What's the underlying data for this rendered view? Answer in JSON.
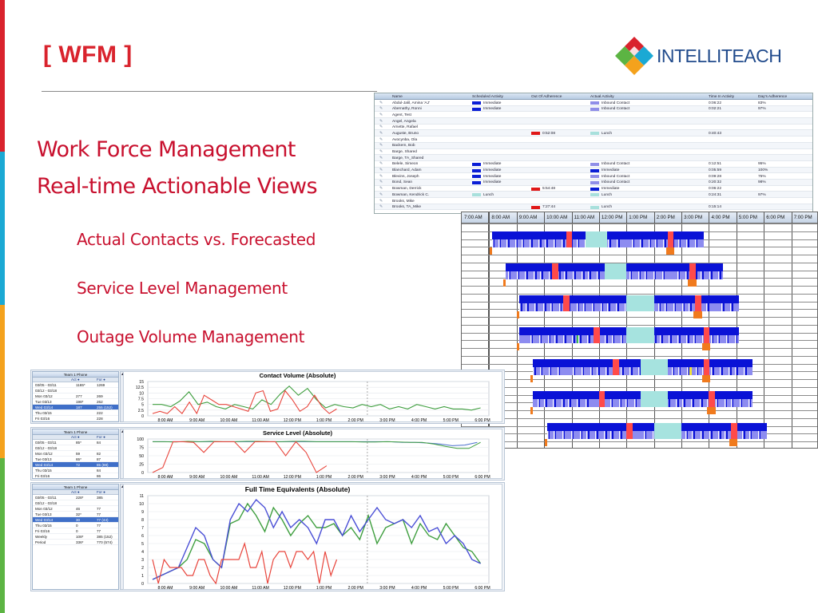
{
  "brand": {
    "edge_colors": [
      "#d9232d",
      "#1ba9d4",
      "#f4a21d",
      "#5cb443"
    ],
    "accent": "#c8102e",
    "logo_colors": [
      "#d9232d",
      "#1ba9d4",
      "#f4a21d",
      "#5cb443"
    ]
  },
  "slide": {
    "tag": "[ WFM ]",
    "headline_1": "Work Force Management",
    "headline_2": "Real-time Actionable Views",
    "bullets": [
      "Actual Contacts vs. Forecasted",
      "Service Level Management",
      "Outage Volume Management"
    ]
  },
  "logo": {
    "text": "INTELLITEACH",
    "icon": "diamond-logo-icon"
  },
  "adherence_table": {
    "columns": [
      "Name",
      "Scheduled Activity",
      "Out Of Adherence",
      "Actual Activity",
      "Time In Activity",
      "Day's Adherence"
    ],
    "rows": [
      {
        "name": "Abdul-Jalil, Amina 'AJ'",
        "sched": "Immediate",
        "out": "",
        "actual": "Inbound Contact",
        "time": "0:06:22",
        "adh": "83%"
      },
      {
        "name": "Abernathy, Ronni",
        "sched": "Immediate",
        "out": "",
        "actual": "Inbound Contact",
        "time": "0:02:21",
        "adh": "97%"
      },
      {
        "name": "Agent, Test",
        "sched": "",
        "out": "",
        "actual": "",
        "time": "",
        "adh": ""
      },
      {
        "name": "Angel, Angela",
        "sched": "",
        "out": "",
        "actual": "",
        "time": "",
        "adh": ""
      },
      {
        "name": "Arnette, Rafael",
        "sched": "",
        "out": "",
        "actual": "",
        "time": "",
        "adh": ""
      },
      {
        "name": "Auguste, Bruno",
        "sched": "",
        "out": "0:52:08",
        "actual": "Lunch",
        "time": "0:40:43",
        "adh": ""
      },
      {
        "name": "Avocynba, Ola",
        "sched": "",
        "out": "",
        "actual": "",
        "time": "",
        "adh": ""
      },
      {
        "name": "Backem, Bob",
        "sched": "",
        "out": "",
        "actual": "",
        "time": "",
        "adh": ""
      },
      {
        "name": "Barge, Shared",
        "sched": "",
        "out": "",
        "actual": "",
        "time": "",
        "adh": ""
      },
      {
        "name": "Barge, TA_Shared",
        "sched": "",
        "out": "",
        "actual": "",
        "time": "",
        "adh": ""
      },
      {
        "name": "Belele, Simeon",
        "sched": "Immediate",
        "out": "",
        "actual": "Inbound Contact",
        "time": "0:12:51",
        "adh": "95%"
      },
      {
        "name": "Blanchard, Adam",
        "sched": "Immediate",
        "out": "",
        "actual": "Immediate",
        "time": "0:05:59",
        "adh": "100%"
      },
      {
        "name": "Blevins, Joseph",
        "sched": "Immediate",
        "out": "",
        "actual": "Inbound Contact",
        "time": "0:09:28",
        "adh": "75%"
      },
      {
        "name": "Bond, Sean",
        "sched": "Immediate",
        "out": "",
        "actual": "Inbound Contact",
        "time": "0:20:32",
        "adh": "98%"
      },
      {
        "name": "Bowman, Derrick",
        "sched": "",
        "out": "5:54:48",
        "actual": "Immediate",
        "time": "0:06:22",
        "adh": ""
      },
      {
        "name": "Bowman, Kendrick C.",
        "sched": "Lunch",
        "out": "",
        "actual": "Lunch",
        "time": "0:24:31",
        "adh": "97%"
      },
      {
        "name": "Brooks, Mike",
        "sched": "",
        "out": "",
        "actual": "",
        "time": "",
        "adh": ""
      },
      {
        "name": "Brooks, TA_Mike",
        "sched": "",
        "out": "7:27:44",
        "actual": "Lunch",
        "time": "0:15:14",
        "adh": ""
      }
    ]
  },
  "gantt": {
    "hours": [
      "7:00 AM",
      "8:00 AM",
      "9:00 AM",
      "10:00 AM",
      "11:00 AM",
      "12:00 PM",
      "1:00 PM",
      "2:00 PM",
      "3:00 PM",
      "4:00 PM",
      "5:00 PM",
      "6:00 PM",
      "7:00 PM"
    ],
    "agents": [
      {
        "start": 8.1,
        "end": 15.8,
        "lunch": [
          11.5,
          12.3
        ],
        "out": [
          10.8,
          14.5
        ]
      },
      {
        "start": 8.6,
        "end": 16.5,
        "lunch": [
          12.2,
          13.0
        ],
        "out": [
          10.3,
          15.3
        ]
      },
      {
        "start": 9.1,
        "end": 17.1,
        "lunch": [
          13.0,
          14.0
        ],
        "out": [
          10.7,
          15.5
        ]
      },
      {
        "start": 9.1,
        "end": 17.1,
        "lunch": [
          13.0,
          14.0
        ],
        "out": [
          11.8,
          15.8
        ]
      },
      {
        "start": 9.6,
        "end": 17.6,
        "lunch": [
          13.5,
          14.5
        ],
        "out": [
          12.5,
          15.8
        ]
      },
      {
        "start": 9.6,
        "end": 17.6,
        "lunch": [
          13.5,
          14.5
        ],
        "out": [
          12.0,
          16.0
        ]
      },
      {
        "start": 10.1,
        "end": 18.1,
        "lunch": [
          14.0,
          15.0
        ],
        "out": [
          13.0,
          16.8
        ]
      }
    ]
  },
  "panels": [
    {
      "side": {
        "title": "Team 1 Phone",
        "col_a": "Act",
        "col_b": "For",
        "rows": [
          {
            "label": "03/05 - 03/11",
            "a": "1165*",
            "b": "1269",
            "hl": false
          },
          {
            "label": "03/12 - 03/18",
            "a": "",
            "b": "",
            "hl": false
          },
          {
            "label": "Mon 03/12",
            "a": "277",
            "b": "269",
            "hl": false
          },
          {
            "label": "Tue 03/13",
            "a": "198*",
            "b": "262",
            "hl": false
          },
          {
            "label": "Wed 03/14",
            "a": "187",
            "b": "255 (152)",
            "hl": true
          },
          {
            "label": "Thu 03/15",
            "a": "",
            "b": "222",
            "hl": false
          },
          {
            "label": "Fri 03/16",
            "a": "",
            "b": "228",
            "hl": false
          },
          {
            "label": "Weekly",
            "a": "660*",
            "b": "1216 (661)",
            "hl": false
          }
        ]
      },
      "chart": {
        "title": "Contact Volume (Absolute)",
        "y_ticks": [
          "15",
          "12.5",
          "10",
          "7.5",
          "5",
          "2.5",
          "0"
        ],
        "x_ticks": [
          "8:00 AM",
          "9:00 AM",
          "10:00 AM",
          "11:00 AM",
          "12:00 PM",
          "1:00 PM",
          "2:00 PM",
          "3:00 PM",
          "4:00 PM",
          "5:00 PM",
          "6:00 PM"
        ]
      }
    },
    {
      "side": {
        "title": "Team 1 Phone",
        "col_a": "Act",
        "col_b": "For",
        "rows": [
          {
            "label": "03/05 - 03/11",
            "a": "85*",
            "b": "84",
            "hl": false
          },
          {
            "label": "03/12 - 03/18",
            "a": "",
            "b": "",
            "hl": false
          },
          {
            "label": "Mon 03/12",
            "a": "59",
            "b": "82",
            "hl": false
          },
          {
            "label": "Tue 03/13",
            "a": "65*",
            "b": "87",
            "hl": false
          },
          {
            "label": "Wed 03/14",
            "a": "72",
            "b": "85 (88)",
            "hl": true
          },
          {
            "label": "Thu 03/15",
            "a": "",
            "b": "84",
            "hl": false
          },
          {
            "label": "Fri 03/16",
            "a": "",
            "b": "86",
            "hl": false
          }
        ]
      },
      "chart": {
        "title": "Service Level (Absolute)",
        "y_ticks": [
          "100",
          "75",
          "50",
          "25",
          "0"
        ],
        "x_ticks": [
          "8:00 AM",
          "9:00 AM",
          "10:00 AM",
          "11:00 AM",
          "12:00 PM",
          "1:00 PM",
          "2:00 PM",
          "3:00 PM",
          "4:00 PM",
          "5:00 PM",
          "6:00 PM"
        ]
      }
    },
    {
      "side": {
        "title": "Team 1 Phone",
        "col_a": "Act",
        "col_b": "For",
        "rows": [
          {
            "label": "03/05 - 03/11",
            "a": "228*",
            "b": "385",
            "hl": false
          },
          {
            "label": "03/12 - 03/18",
            "a": "",
            "b": "",
            "hl": false
          },
          {
            "label": "Mon 03/12",
            "a": "46",
            "b": "77",
            "hl": false
          },
          {
            "label": "Tue 03/13",
            "a": "32*",
            "b": "77",
            "hl": false
          },
          {
            "label": "Wed 03/14",
            "a": "30",
            "b": "77 (44)",
            "hl": true
          },
          {
            "label": "Thu 03/15",
            "a": "0",
            "b": "77",
            "hl": false
          },
          {
            "label": "Fri 03/16",
            "a": "0",
            "b": "77",
            "hl": false
          },
          {
            "label": "Weekly",
            "a": "108*",
            "b": "385 (152)",
            "hl": false
          },
          {
            "label": "Period",
            "a": "336*",
            "b": "770 (574)",
            "hl": false
          }
        ]
      },
      "chart": {
        "title": "Full Time Equivalents (Absolute)",
        "y_ticks": [
          "11",
          "10",
          "9",
          "8",
          "7",
          "6",
          "5",
          "4",
          "3",
          "2",
          "1",
          "0"
        ],
        "x_ticks": [
          "8:00 AM",
          "9:00 AM",
          "10:00 AM",
          "11:00 AM",
          "12:00 PM",
          "1:00 PM",
          "2:00 PM",
          "3:00 PM",
          "4:00 PM",
          "5:00 PM",
          "6:00 PM"
        ]
      }
    }
  ]
}
